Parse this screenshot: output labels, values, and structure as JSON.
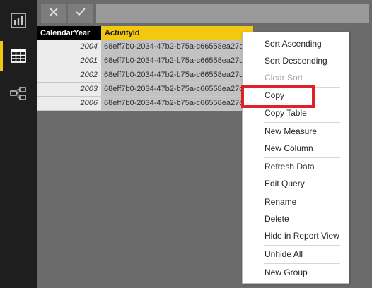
{
  "nav": {
    "items": [
      {
        "name": "report-view",
        "icon": "bar-chart-icon",
        "active": false
      },
      {
        "name": "data-view",
        "icon": "table-grid-icon",
        "active": true
      },
      {
        "name": "relationships-view",
        "icon": "relationships-icon",
        "active": false
      }
    ]
  },
  "formula_bar": {
    "cancel_icon": "close-icon",
    "commit_icon": "checkmark-icon",
    "value": ""
  },
  "table": {
    "columns": [
      "CalendarYear",
      "ActivityId"
    ],
    "selected_column": "ActivityId",
    "rows": [
      {
        "year": "2004",
        "activity": "68eff7b0-2034-47b2-b75a-c66558ea27c"
      },
      {
        "year": "2001",
        "activity": "68eff7b0-2034-47b2-b75a-c66558ea27c"
      },
      {
        "year": "2002",
        "activity": "68eff7b0-2034-47b2-b75a-c66558ea27c"
      },
      {
        "year": "2003",
        "activity": "68eff7b0-2034-47b2-b75a-c66558ea27c"
      },
      {
        "year": "2006",
        "activity": "68eff7b0-2034-47b2-b75a-c66558ea27c"
      }
    ]
  },
  "context_menu": {
    "items": [
      "Sort Ascending",
      "Sort Descending",
      "Clear Sort",
      "Copy",
      "Copy Table",
      "New Measure",
      "New Column",
      "Refresh Data",
      "Edit Query",
      "Rename",
      "Delete",
      "Hide in Report View",
      "Unhide All",
      "New Group"
    ],
    "disabled_items": [
      "Clear Sort"
    ],
    "highlighted_item": "Copy"
  },
  "colors": {
    "accent": "#f2c811",
    "highlight": "#e0212b",
    "rail": "#1e1e1e",
    "canvas": "#6b6b6b"
  }
}
